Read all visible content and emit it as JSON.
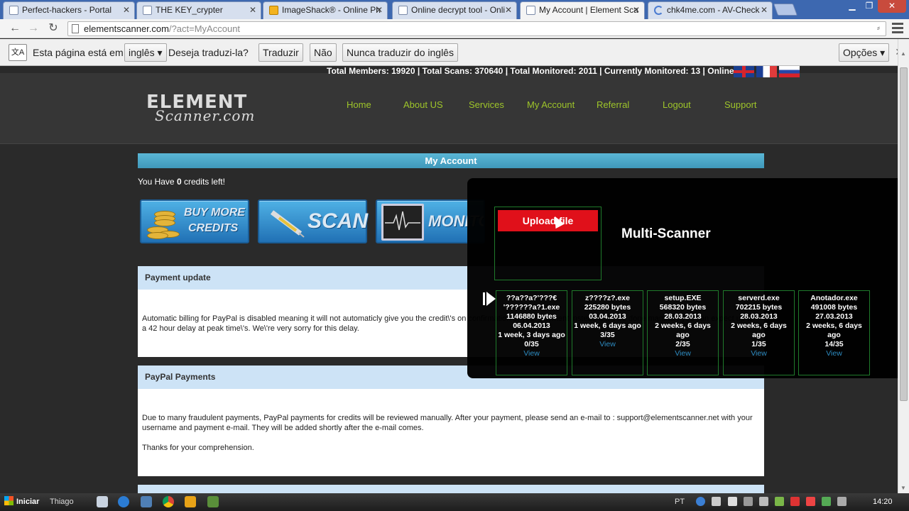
{
  "browser": {
    "tabs": [
      {
        "title": "Perfect-hackers - Portal"
      },
      {
        "title": "THE KEY_crypter"
      },
      {
        "title": "ImageShack® - Online Ph"
      },
      {
        "title": "Online decrypt tool - Onli"
      },
      {
        "title": "My Account | Element Sca"
      },
      {
        "title": "chk4me.com - AV-Check"
      }
    ],
    "url_host": "elementscanner.com",
    "url_path": "/?act=MyAccount"
  },
  "translate_bar": {
    "prefix": "Esta página está em",
    "language": "inglês ▾",
    "question": "Deseja traduzi-la?",
    "translate": "Traduzir",
    "no": "Não",
    "never": "Nunca traduzir do inglês",
    "options": "Opções ▾"
  },
  "site": {
    "stats": "Total Members: 19920 | Total Scans: 370640 | Total Monitored: 2011 | Currently Monitored: 13 | Online: 27",
    "logo_line1": "ELEMENT",
    "logo_line2": "Scanner.com",
    "nav": [
      "Home",
      "About US",
      "Services",
      "My Account",
      "Referral",
      "Logout",
      "Support"
    ],
    "page_title": "My Account",
    "credits_prefix": "You Have ",
    "credits_value": "0",
    "credits_suffix": " credits left!",
    "buttons": {
      "buy_line1": "BUY MORE",
      "buy_line2": "CREDITS",
      "scan": "SCAN",
      "monitor": "MONITOR"
    },
    "panels": [
      {
        "heading": "Payment update",
        "body": "Automatic billing for PayPal is disabled meaning it will not automaticly give you the credit\\'s on confirmation of your payment instead it will be done manually you can expect up to a 42 hour delay at peak time\\'s. We\\'re very sorry for this delay."
      },
      {
        "heading": "PayPal Payments",
        "body": "Due to many fraudulent payments, PayPal payments for credits will be reviewed manually. After your payment, please send an e-mail to : support@elementscanner.net with your username and payment e-mail. They will be added shortly after the e-mail comes.",
        "body2": "Thanks for your comprehension."
      }
    ]
  },
  "overlay": {
    "upload_label": "Upload file",
    "title": "Multi-Scanner",
    "files": [
      {
        "name": "??a??a?'???€ '??????a?1.exe",
        "size": "1146880 bytes",
        "date": "06.04.2013",
        "age": "1 week, 3 days ago",
        "detections": "0/35",
        "view": "View"
      },
      {
        "name": "z????z?.exe",
        "size": "225280 bytes",
        "date": "03.04.2013",
        "age": "1 week, 6 days ago",
        "detections": "3/35",
        "view": "View"
      },
      {
        "name": "setup.EXE",
        "size": "568320 bytes",
        "date": "28.03.2013",
        "age": "2 weeks, 6 days ago",
        "detections": "2/35",
        "view": "View"
      },
      {
        "name": "serverd.exe",
        "size": "702215 bytes",
        "date": "28.03.2013",
        "age": "2 weeks, 6 days ago",
        "detections": "1/35",
        "view": "View"
      },
      {
        "name": "Anotador.exe",
        "size": "491008 bytes",
        "date": "27.03.2013",
        "age": "2 weeks, 6 days ago",
        "detections": "14/35",
        "view": "View"
      }
    ]
  },
  "taskbar": {
    "start": "Iniciar",
    "user": "Thiago",
    "lang": "PT",
    "clock": "14:20"
  }
}
